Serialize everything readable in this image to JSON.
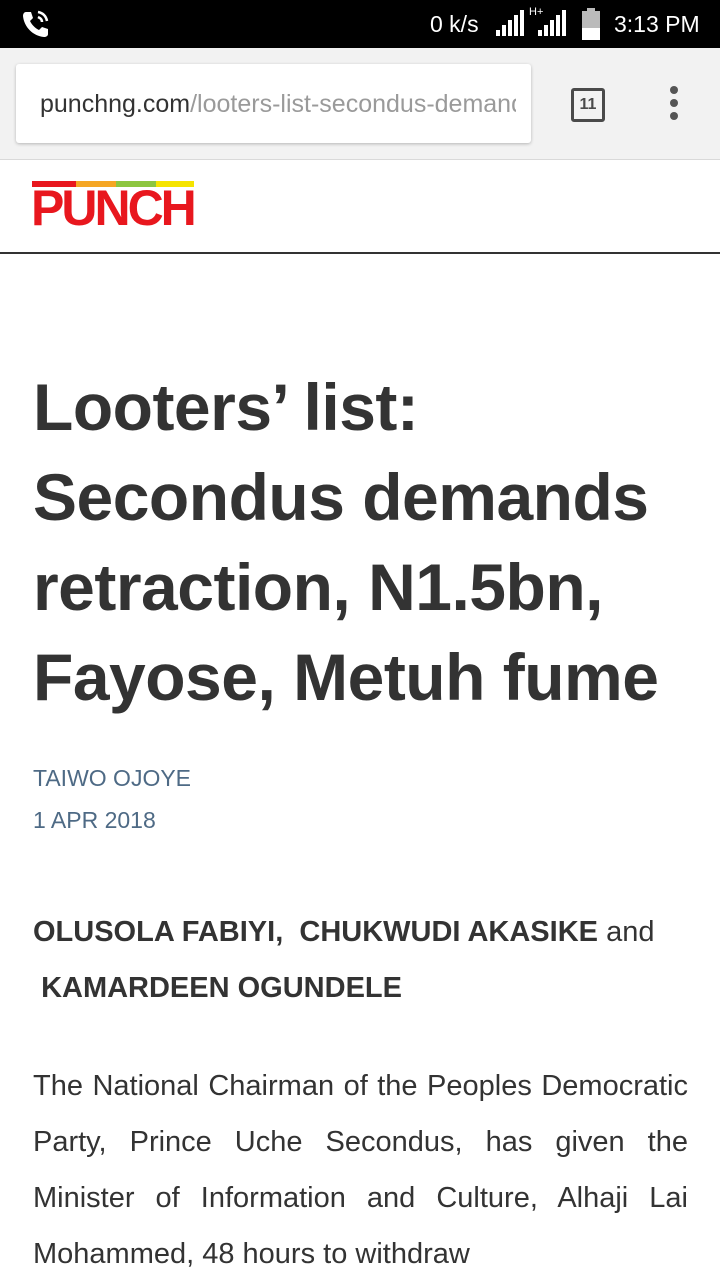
{
  "status_bar": {
    "net_speed": "0 k/s",
    "network_type": "H+",
    "time": "3:13 PM",
    "icons": [
      "call-icon",
      "signal-icon",
      "signal-icon",
      "battery-icon"
    ]
  },
  "browser": {
    "url_host": "punchng.com",
    "url_path": "/looters-list-secondus-demands-retraction",
    "tab_count": "11",
    "menu_icon": "more-vertical-icon"
  },
  "site": {
    "logo_text": "PUNCH",
    "logo_colors": [
      "#e8171e",
      "#f5a623",
      "#8dc63f",
      "#f5e400"
    ]
  },
  "article": {
    "headline": "Looters’ list: Secondus demands retraction, N1.5bn, Fayose, Metuh fume",
    "byline": "TAIWO OJOYE",
    "date": "1 APR 2018",
    "authors": {
      "author1": "OLUSOLA FABIYI,",
      "author2": "CHUKWUDI AKASIKE",
      "connector": "and",
      "author3": "KAMARDEEN OGUNDELE"
    },
    "body": "The National Chairman of the Peoples Democratic Party, Prince Uche Secondus, has given the Minister of Information and Culture, Alhaji Lai Mohammed, 48 hours to withdraw"
  },
  "colors": {
    "meta_text": "#4e6a85",
    "headline_text": "#333333",
    "logo_red": "#e8171e"
  }
}
